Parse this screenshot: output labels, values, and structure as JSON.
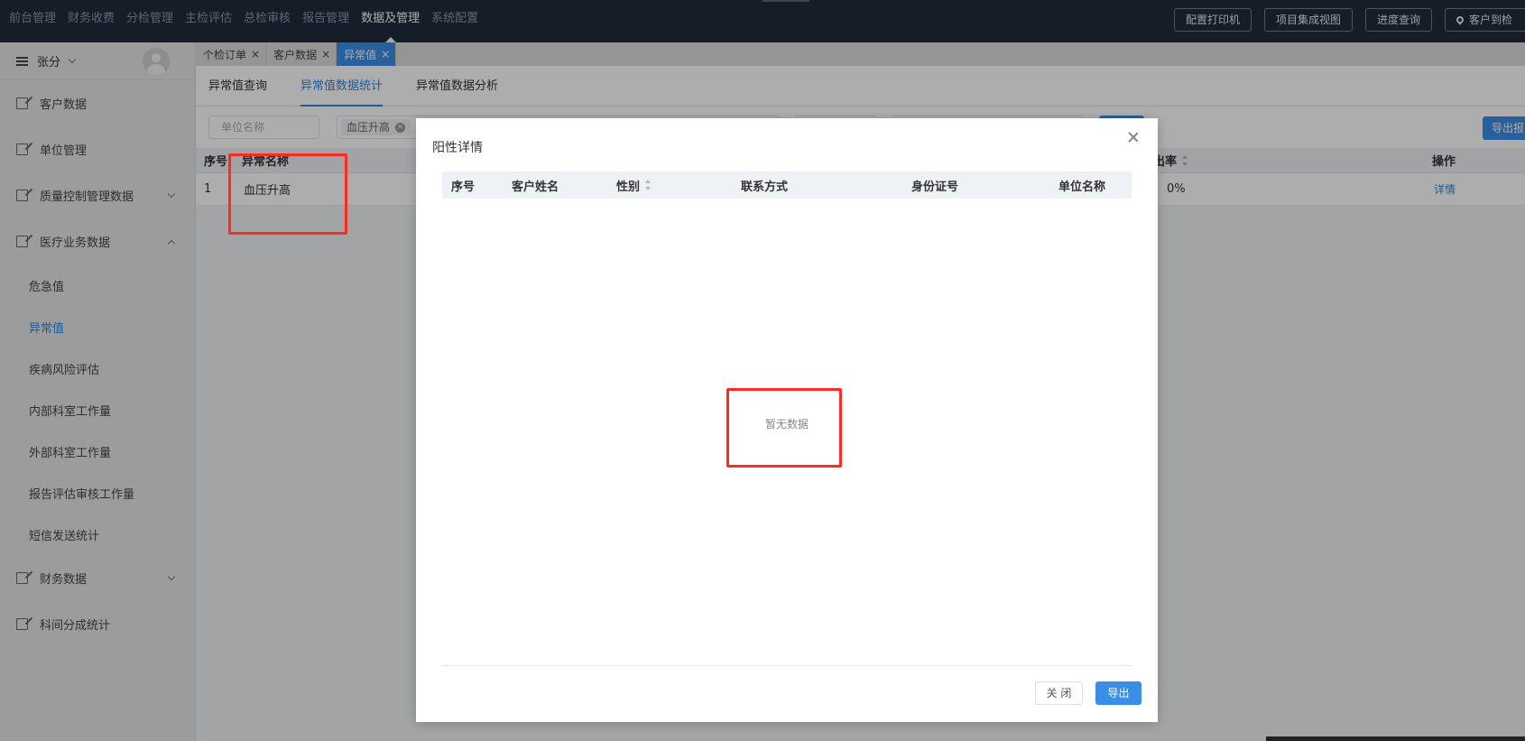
{
  "topnav": {
    "items": [
      "前台管理",
      "财务收费",
      "分检管理",
      "主检评估",
      "总检审核",
      "报告管理",
      "数据及管理",
      "系统配置"
    ],
    "active_index": 6
  },
  "top_actions": [
    "配置打印机",
    "项目集成视图",
    "进度查询",
    "客户到检"
  ],
  "sidebar": {
    "user": "张分",
    "items": [
      {
        "label": "客户数据"
      },
      {
        "label": "单位管理"
      },
      {
        "label": "质量控制管理数据"
      },
      {
        "label": "医疗业务数据"
      }
    ],
    "subitems": [
      "危急值",
      "异常值",
      "疾病风险评估",
      "内部科室工作量",
      "外部科室工作量",
      "报告评估审核工作量",
      "短信发送统计"
    ],
    "active_sub": 1,
    "items_after": [
      {
        "label": "财务数据"
      },
      {
        "label": "科间分成统计"
      }
    ]
  },
  "tabs": [
    {
      "label": "个检订单",
      "close": "×"
    },
    {
      "label": "客户数据",
      "close": "×"
    },
    {
      "label": "异常值",
      "close": "×"
    }
  ],
  "subtabs": [
    "异常值查询",
    "异常值数据统计",
    "异常值数据分析"
  ],
  "filters": {
    "unit_placeholder": "单位名称",
    "selected_tag": "血压升高",
    "export_label": "导出报"
  },
  "table": {
    "headers": {
      "index": "序号",
      "name": "异常名称",
      "rate": "出率",
      "action": "操作"
    },
    "rows": [
      {
        "index": "1",
        "name": "血压升高",
        "rate": "0%",
        "action": "详情"
      }
    ]
  },
  "dialog": {
    "title": "阳性详情",
    "headers": [
      "序号",
      "客户姓名",
      "性别",
      "联系方式",
      "身份证号",
      "单位名称"
    ],
    "empty_text": "暂无数据",
    "close_label": "关 闭",
    "export_label": "导出"
  },
  "colors": {
    "accent": "#3a8ee6",
    "annotation": "#ff2a20",
    "topbar": "#1e2b3c"
  }
}
